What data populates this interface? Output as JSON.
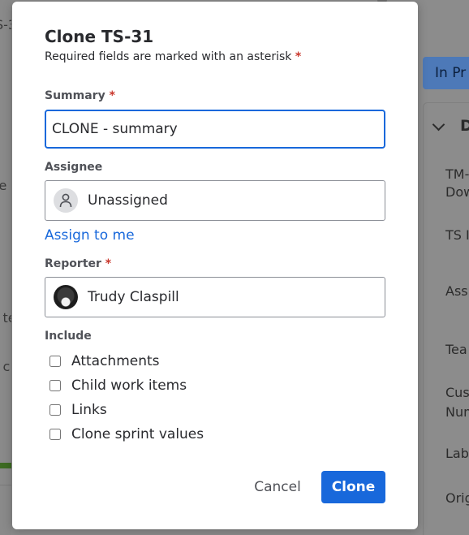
{
  "background": {
    "left_fragments": [
      "S-3",
      "le",
      "l te",
      "l c"
    ],
    "status_button": "In Pr",
    "details_heading": "D",
    "fields": [
      "TM-",
      "Dow",
      "TS I",
      "Ass",
      "Tea",
      "Cus",
      "Num",
      "Lab",
      "Orig"
    ]
  },
  "dialog": {
    "title": "Clone TS-31",
    "required_note": "Required fields are marked with an asterisk",
    "asterisk": "*",
    "summary": {
      "label": "Summary",
      "value": "CLONE - summary"
    },
    "assignee": {
      "label": "Assignee",
      "value": "Unassigned",
      "assign_to_me": "Assign to me"
    },
    "reporter": {
      "label": "Reporter",
      "value": "Trudy Claspill"
    },
    "include": {
      "label": "Include",
      "options": [
        {
          "label": "Attachments",
          "checked": false
        },
        {
          "label": "Child work items",
          "checked": false
        },
        {
          "label": "Links",
          "checked": false
        },
        {
          "label": "Clone sprint values",
          "checked": false
        }
      ]
    },
    "buttons": {
      "cancel": "Cancel",
      "clone": "Clone"
    }
  },
  "colors": {
    "primary": "#1868db",
    "required": "#c9372c",
    "text": "#292a2e"
  }
}
